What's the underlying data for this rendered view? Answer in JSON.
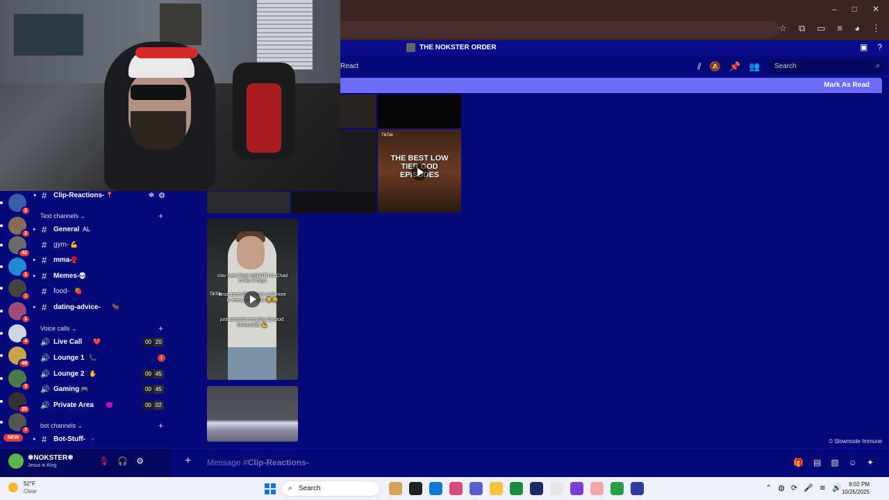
{
  "window": {
    "minimize": "–",
    "maximize": "□",
    "close": "✕"
  },
  "server": {
    "title": "THE NOKSTER ORDER"
  },
  "channel_header": {
    "left_label": "React",
    "search_placeholder": "Search"
  },
  "banner": {
    "mark_as_read": "Mark As Read"
  },
  "rail": {
    "servers": [
      {
        "badge": "2",
        "color": "#3b5ea8"
      },
      {
        "badge": "2",
        "color": "#8a6a5c"
      },
      {
        "badge": "42",
        "color": "#6b6b6b"
      },
      {
        "badge": "1",
        "color": "#1f8ad6"
      },
      {
        "badge": "1",
        "color": "#444444"
      },
      {
        "badge": "1",
        "color": "#a04a7a"
      },
      {
        "badge": "4",
        "color": "#cfd6e8"
      },
      {
        "badge": "49",
        "color": "#c8a34a"
      },
      {
        "badge": "3",
        "color": "#4a7a4a"
      },
      {
        "badge": "25",
        "color": "#333333"
      },
      {
        "badge": "7",
        "color": "#555555"
      }
    ],
    "new_label": "NEW"
  },
  "sidebar": {
    "current_channel": "Clip-Reactions-",
    "text_category": "Text channels",
    "text_channels": [
      {
        "name": "General",
        "suffix": "AL",
        "unread": true
      },
      {
        "name": "gym-",
        "suffix": "💪",
        "unread": false
      },
      {
        "name": "mma-",
        "suffix": "🥊",
        "unread": true
      },
      {
        "name": "Memes-",
        "suffix": "💀",
        "unread": true
      },
      {
        "name": "food-",
        "suffix": "🍓",
        "unread": false
      },
      {
        "name": "dating-advice-",
        "suffix": "🐂",
        "unread": true
      }
    ],
    "voice_category": "Voice calls",
    "voice_channels": [
      {
        "name": "Live Call",
        "suffix": "❤️",
        "count_a": "00",
        "count_b": "20",
        "red": ""
      },
      {
        "name": "Lounge 1",
        "suffix": "📞",
        "count_a": "",
        "count_b": "",
        "red": "1"
      },
      {
        "name": "Lounge 2",
        "suffix": "✋",
        "count_a": "00",
        "count_b": "45",
        "red": ""
      },
      {
        "name": "Gaming",
        "suffix": "🎮",
        "count_a": "00",
        "count_b": "45",
        "red": ""
      },
      {
        "name": "Private Area",
        "suffix": "😈",
        "count_a": "00",
        "count_b": "02",
        "red": ""
      }
    ],
    "bot_category": "bot channels",
    "bot_channels": [
      {
        "name": "Bot-Stuff-",
        "suffix": "▫"
      }
    ]
  },
  "feed": {
    "clip1_caption_a": "clav went from mid HTN to Chad in like 3 days",
    "clip1_caption_b": "bros ascending more and more in every new post 😂😂",
    "clip1_caption_c": "just ascend everyday dooood. broooostal 💪",
    "clip2_title": "THE BEST LOW TIER GOD EPISODES",
    "tiktok": "TikTok"
  },
  "footer": {
    "slowmode": "Slowmode Immune"
  },
  "user": {
    "name": "❄NOKSTER❄",
    "status": "Jesus is King"
  },
  "composer": {
    "placeholder_prefix": "Message #",
    "placeholder_channel": "Clip-Reactions-"
  },
  "taskbar": {
    "temp": "52°F",
    "condition": "Clear",
    "search": "Search",
    "time": "8:02 PM",
    "date": "10/25/2025",
    "apps": [
      "#d9a25a",
      "#222222",
      "#0f7bd6",
      "#d8497c",
      "#5a5fd1",
      "#f3c33b",
      "#1d8a3c",
      "#1b2b66",
      "#e6e6e6",
      "#7a3fd0",
      "#f0a8a8",
      "#2a9d46",
      "#303a9a"
    ]
  }
}
